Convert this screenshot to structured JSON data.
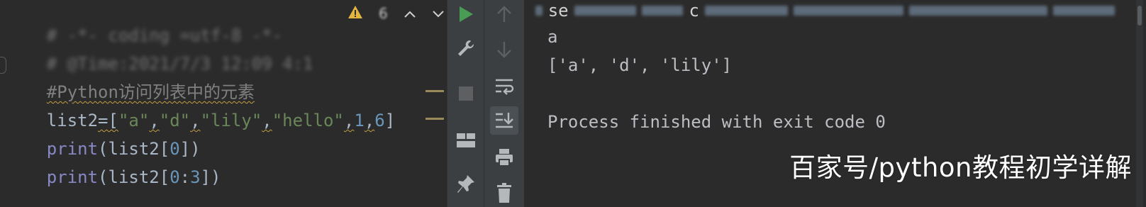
{
  "editor": {
    "line1_comment": "# -*- coding =utf-8 -*-",
    "line2_comment": "# @Time:2021/7/3 12:09 4:1",
    "line3_comment": "#Python访问列表中的元素",
    "code": {
      "list_name": "list2",
      "op": "=[",
      "items": [
        "\"a\"",
        "\"d\"",
        "\"lily\"",
        "\"hello\"",
        "1",
        "6"
      ],
      "close": "]",
      "print1_kw": "print",
      "print1_args": "(list2[",
      "print1_index": "0",
      "print1_close": "])",
      "print2_kw": "print",
      "print2_args": "(list2[",
      "print2_index_start": "0",
      "print2_colon": ":",
      "print2_index_end": "3",
      "print2_close": "])"
    },
    "status": {
      "warning_count": "6",
      "up": "^",
      "down": "v"
    }
  },
  "toolbar_left": [
    "run-icon",
    "wrench-icon",
    "stop-icon",
    "layout-icon",
    "pin-icon"
  ],
  "toolbar_right": [
    "arrow-up-icon",
    "arrow-down-icon",
    "soft-wrap-icon",
    "scroll-to-end-icon",
    "print-icon",
    "trash-icon"
  ],
  "console": {
    "header_letter_s": "se",
    "header_letter_c": "c",
    "output_line1": "a",
    "output_line2": "['a', 'd', 'lily']",
    "output_line3": "Process finished with exit code 0"
  },
  "watermark": "百家号/python教程初学详解",
  "colors": {
    "run_green": "#499c54",
    "string_green": "#6a8759",
    "number_blue": "#6897bb",
    "keyword_purple": "#8888c6",
    "comment_gray": "#808080"
  }
}
